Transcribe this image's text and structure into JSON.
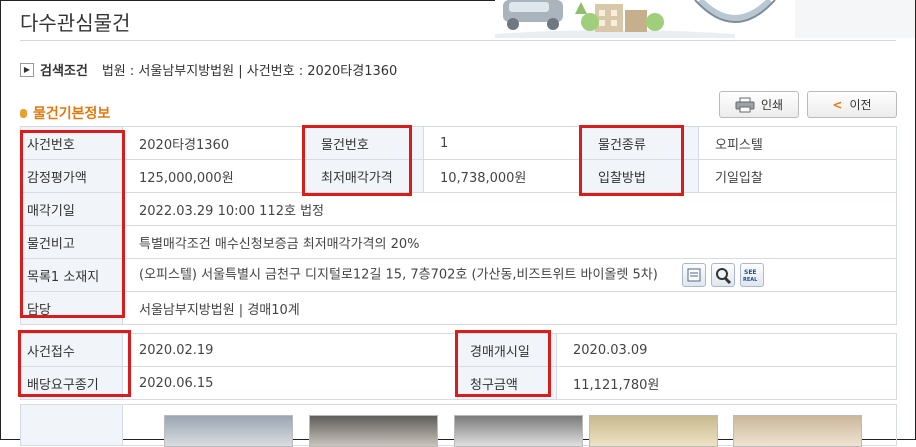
{
  "page": {
    "title": "다수관심물건"
  },
  "search": {
    "label": "검색조건",
    "text": "법원 : 서울남부지방법원 | 사건번호 : 2020타경1360"
  },
  "section": {
    "title": "물건기본정보"
  },
  "buttons": {
    "print": "인쇄",
    "prev": "이전"
  },
  "basic": {
    "case_no": {
      "label": "사건번호",
      "value": "2020타경1360"
    },
    "item_no": {
      "label": "물건번호",
      "value": "1"
    },
    "item_type": {
      "label": "물건종류",
      "value": "오피스텔"
    },
    "appraisal": {
      "label": "감정평가액",
      "value": "125,000,000원"
    },
    "min_price": {
      "label": "최저매각가격",
      "value": "10,738,000원"
    },
    "bid_method": {
      "label": "입찰방법",
      "value": "기일입찰"
    },
    "sale_date": {
      "label": "매각기일",
      "value": "2022.03.29 10:00 112호 법정"
    },
    "remarks": {
      "label": "물건비고",
      "value": "특별매각조건 매수신청보증금 최저매각가격의 20%"
    },
    "address": {
      "label": "목록1 소재지",
      "value": "(오피스텔) 서울특별시 금천구 디지털로12길 15, 7층702호 (가산동,비즈트위트 바이올렛 5차)"
    },
    "manager": {
      "label": "담당",
      "value": "서울남부지방법원 | 경매10계"
    }
  },
  "dates": {
    "received": {
      "label": "사건접수",
      "value": "2020.02.19"
    },
    "started": {
      "label": "경매개시일",
      "value": "2020.03.09"
    },
    "deadline": {
      "label": "배당요구종기",
      "value": "2020.06.15"
    },
    "claim": {
      "label": "청구금액",
      "value": "11,121,780원"
    }
  },
  "icons": [
    "document-icon",
    "map-search-icon",
    "see-real-icon"
  ],
  "colors": {
    "highlight": "#d81d1d",
    "section_accent": "#e07a10",
    "label_bg": "#f1f4f8"
  }
}
